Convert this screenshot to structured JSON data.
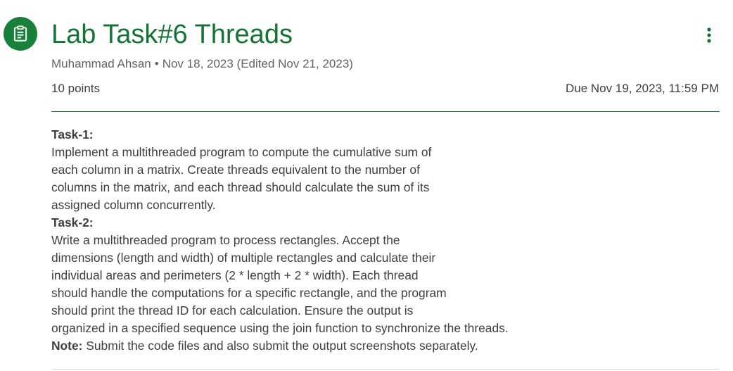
{
  "assignment": {
    "icon": "assignment-icon",
    "title": "Lab Task#6 Threads",
    "author": "Muhammad Ahsan",
    "separator": "•",
    "posted": "Nov 18, 2023 (Edited Nov 21, 2023)",
    "points": "10 points",
    "due": "Due Nov 19, 2023, 11:59 PM",
    "more_icon": "more-vert-icon"
  },
  "instructions": {
    "task1_heading": "Task-1:",
    "task1_lines": [
      "Implement a multithreaded program to compute the cumulative sum of",
      "each column in a matrix. Create threads equivalent to the number of",
      "columns in the matrix, and each thread should calculate the sum of its",
      "assigned column concurrently."
    ],
    "task2_heading": "Task-2:",
    "task2_lines": [
      "Write a multithreaded program to process rectangles. Accept the",
      "dimensions (length and width) of multiple rectangles and calculate their",
      "individual areas and perimeters (2 * length + 2 * width). Each thread",
      "should handle the computations for a specific rectangle, and the program",
      "should print the thread ID for each calculation. Ensure the output is",
      "organized in a specified sequence using the join function to synchronize the threads."
    ],
    "note_label": "Note:",
    "note_text": " Submit the code files and also submit the output screenshots separately."
  },
  "colors": {
    "accent": "#137333",
    "icon_bg": "#188038"
  }
}
